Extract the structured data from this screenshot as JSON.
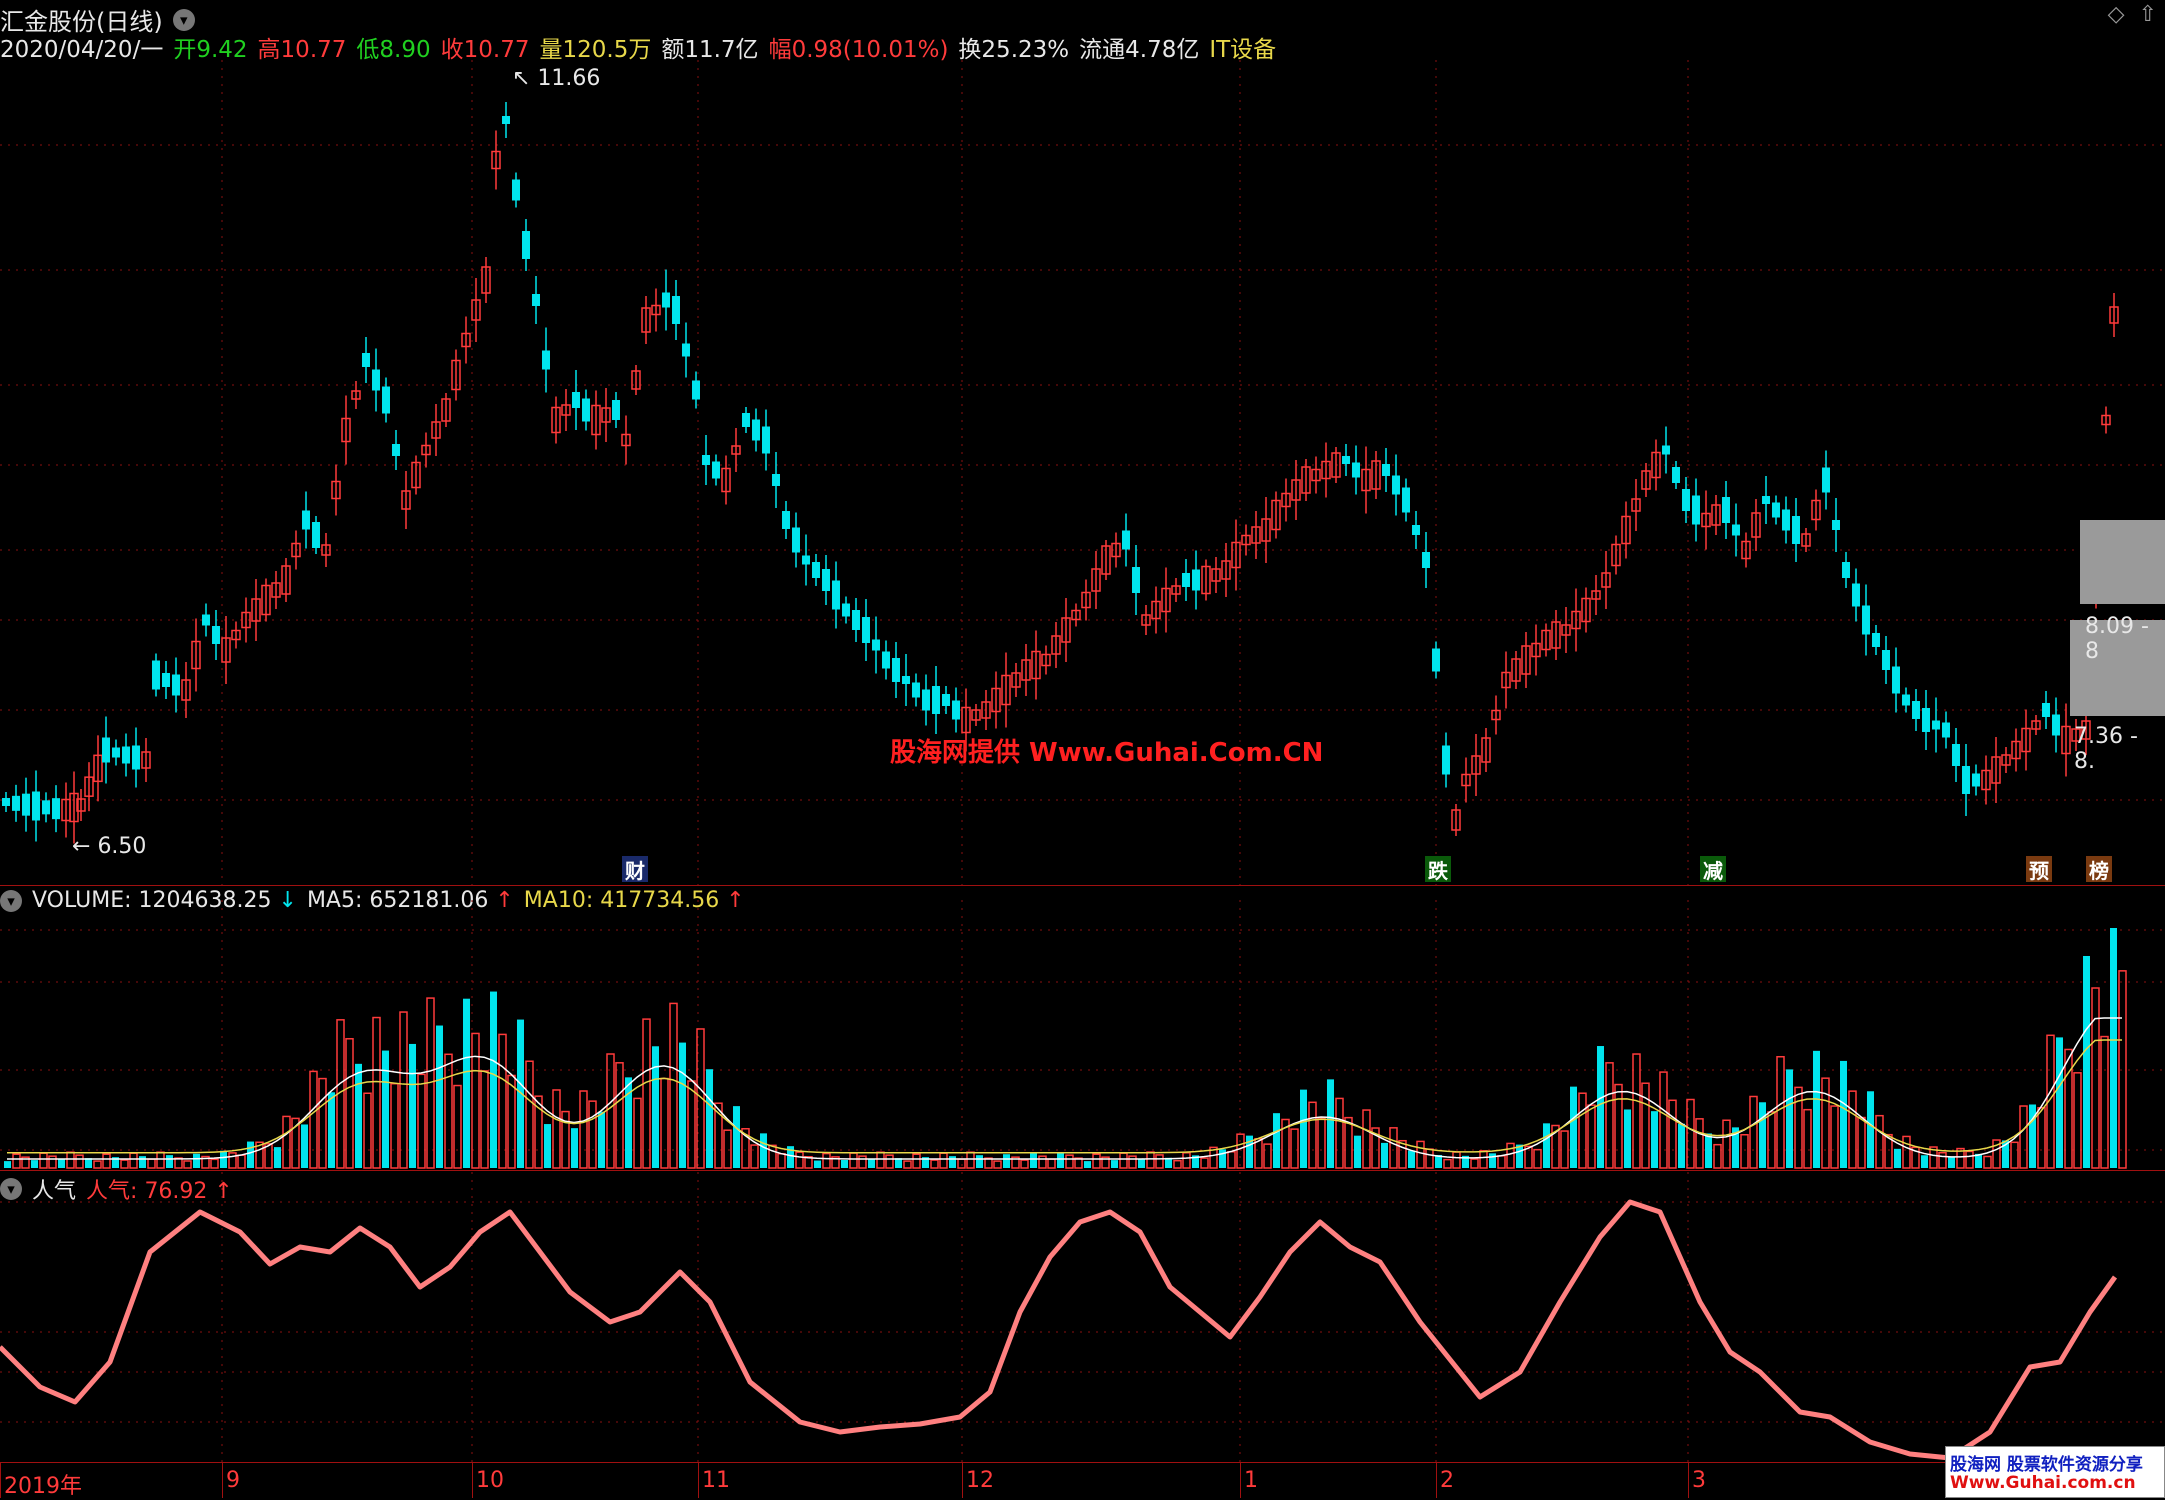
{
  "header": {
    "stock_name": "汇金股份",
    "period": "(日线)",
    "date": "2020/04/20/一",
    "fields": [
      {
        "label": "开",
        "value": "9.42",
        "color": "green"
      },
      {
        "label": "高",
        "value": "10.77",
        "color": "red"
      },
      {
        "label": "低",
        "value": "8.90",
        "color": "green"
      },
      {
        "label": "收",
        "value": "10.77",
        "color": "red"
      },
      {
        "label": "量",
        "value": "120.5万",
        "color": "yellow"
      },
      {
        "label": "额",
        "value": "11.7亿",
        "color": "white"
      },
      {
        "label": "幅",
        "value": "0.98(10.01%)",
        "color": "red"
      },
      {
        "label": "换",
        "value": "25.23%",
        "color": "white"
      },
      {
        "label": "流通",
        "value": "4.78亿",
        "color": "white"
      }
    ],
    "sector": "IT设备",
    "corner_icons": [
      "diamond-icon",
      "up-arrow-icon"
    ]
  },
  "price_chart": {
    "high_label": "11.66",
    "low_label": "6.50",
    "zone_labels": [
      "8.09 - 8",
      "7.36 - 8."
    ],
    "watermark": "股海网提供 Www.Guhai.Com.CN",
    "events": [
      {
        "text": "财",
        "bg": "#1a2a6a",
        "fg": "#fff"
      },
      {
        "text": "跌",
        "bg": "#0a5a0a",
        "fg": "#fff"
      },
      {
        "text": "减",
        "bg": "#0a5a0a",
        "fg": "#fff"
      },
      {
        "text": "预",
        "bg": "#7a3a10",
        "fg": "#fff"
      },
      {
        "text": "榜",
        "bg": "#7a3a10",
        "fg": "#fff"
      }
    ]
  },
  "volume_panel": {
    "name": "VOLUME",
    "value": "1204638.25",
    "ma5_label": "MA5",
    "ma5_value": "652181.06",
    "ma10_label": "MA10",
    "ma10_value": "417734.56"
  },
  "popularity_panel": {
    "name": "人气",
    "series_label": "人气",
    "value": "76.92"
  },
  "x_axis": {
    "labels": [
      "2019年",
      "9",
      "10",
      "11",
      "12",
      "1",
      "2",
      "3"
    ]
  },
  "brand": {
    "top": "股海网 股票软件资源分享",
    "bottom": "Www.Guhai.com.cn"
  },
  "colors": {
    "up": "#ff3b3b",
    "down": "#00e5ee",
    "ma5": "#ffffff",
    "ma10": "#e8d84a",
    "popularity_line": "#ff8080",
    "grid": "#8a1010"
  }
}
